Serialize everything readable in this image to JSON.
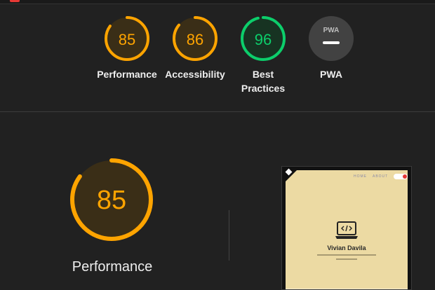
{
  "gauges": [
    {
      "score": "85",
      "label": "Performance",
      "color": "#ffa400",
      "fraction": 0.85
    },
    {
      "score": "86",
      "label": "Accessibility",
      "color": "#ffa400",
      "fraction": 0.86
    },
    {
      "score": "96",
      "label": "Best Practices",
      "color": "#0cce6b",
      "fraction": 0.96
    },
    {
      "label": "PWA",
      "badge": "PWA",
      "color": "#9e9e9e"
    }
  ],
  "performance": {
    "score": "85",
    "label": "Performance",
    "color": "#ffa400",
    "fraction": 0.85
  },
  "thumbnail": {
    "nav_home": "HOME",
    "nav_about": "ABOUT",
    "name": "Vivian Davila",
    "icon": "laptop-code-icon"
  }
}
